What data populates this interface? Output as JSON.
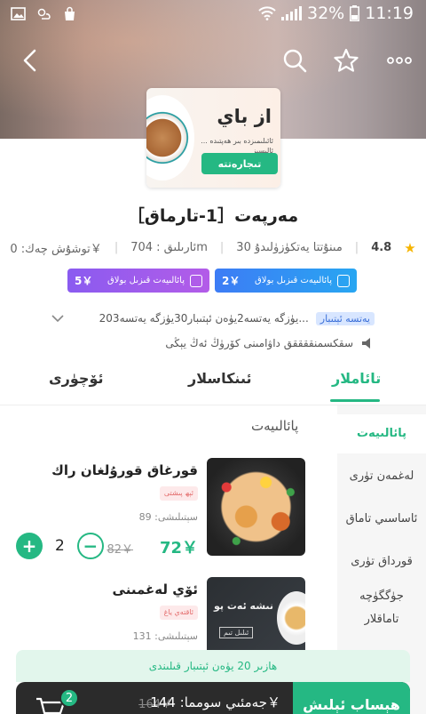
{
  "status_bar": {
    "battery": "32%",
    "time": "11:19"
  },
  "shop": {
    "cover_title": "از باي",
    "cover_subtitle": "ئائىلىمىزدە بىر ھەپتىدە ... ئالىسىز",
    "cover_button": "تىجارەتتە",
    "name": "مەرپەت［1-تارماق］",
    "rating": "4.8",
    "monthly_sales": "30 مىنۇتتا يەتكۈزۈلىدۇ",
    "distance": "ئارىلىق : 704m",
    "delivery_fee": "توشۇش چەك: 0￥"
  },
  "coupons": [
    {
      "amount": "5￥",
      "label": "پائالىيەت قىزىل بولاق"
    },
    {
      "amount": "2￥",
      "label": "پائالىيەت قىزىل بولاق"
    }
  ],
  "promo": {
    "badge": "يەتسە ئېتىبار",
    "text": "20يۈزگە يەتسە2يۈەن ئېتىبار30يۈزگە يەتسە3..."
  },
  "notice": {
    "text": "سقكسمنققققق داۋامىنى كۆرۈڭ ئەڭ يېڭى"
  },
  "tabs": [
    {
      "label": "تائاملار"
    },
    {
      "label": "ئىنكاسلار"
    },
    {
      "label": "ئۆچۈرى"
    }
  ],
  "section_title": "پائالىيەت",
  "categories": [
    {
      "label": "پائالىيەت"
    },
    {
      "label": "لەغمەن تۈرى"
    },
    {
      "label": "ئاساسىي تاماق"
    },
    {
      "label": "قورداق تۈرى"
    },
    {
      "label": "جۈگگۈچە تاماقلار"
    }
  ],
  "dishes": [
    {
      "name": "قورغاق قورۇلغان راك",
      "tag": "ئېھ پىشتى",
      "sales": "سېتىلىشى: 89",
      "price": "72￥",
      "old_price": "82￥",
      "quantity": "2"
    },
    {
      "name": "ئۆي لەغمىنى",
      "tag": "ئاقتەي ياغ",
      "sales": "سېتىلىشى: 131",
      "chalk_title": "نىشە ئەت پو",
      "chalk_sub": "ئىلىل تىم"
    }
  ],
  "coupon_bar": "ھازىر 20 يۈەن ئېتىبار قىلىندى",
  "bottom": {
    "total": "جەمئىي سومما: 144￥",
    "old_total": "164￥",
    "cart_count": "2",
    "checkout": "ھېساب ئېلىش"
  }
}
